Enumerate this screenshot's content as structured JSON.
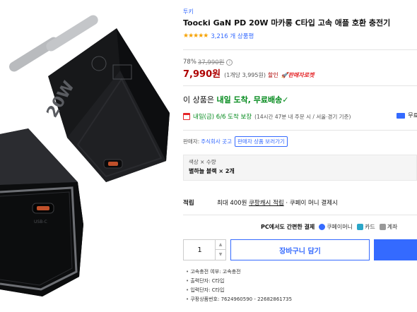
{
  "product": {
    "brand": "투키",
    "title": "Toocki GaN PD 20W 마카롱 C타입 고속 애플 호환 충전기",
    "stars": "★★★★★",
    "review_count": "3,216 개 상품평"
  },
  "price": {
    "discount_rate": "78%",
    "original_price": "37,990원",
    "sale_price": "7,990원",
    "unit_price": "(1개당 3,995원)",
    "sale_label": "할인",
    "rocket_badge": "판매자로켓"
  },
  "delivery": {
    "headline_prefix": "이 상품은",
    "headline_highlight": "내일 도착, 무료배송",
    "check": "✓",
    "date": "내일(금) 6/6 도착 보장",
    "note": "(14시간 47분 내 주문 시 / 서울⋅경기 기준)",
    "free_shipping": "무료"
  },
  "seller": {
    "label": "판매자:",
    "name": "주식회사 곳고",
    "view_button": "판매자 상품 보러가기"
  },
  "option": {
    "label": "색상 × 수량",
    "value": "별하늘 블랙 × 2개"
  },
  "cash": {
    "label": "적립",
    "prefix": "최대 400원",
    "highlight": "쿠팡캐시 적립",
    "suffix": "· 쿠페이 머니 결제시"
  },
  "payment": {
    "title": "PC에서도 간편한 결제",
    "methods": [
      {
        "label": "쿠페이머니",
        "color": "#346aff"
      },
      {
        "label": "카드",
        "color": "#2aa6c8"
      },
      {
        "label": "계좌",
        "color": "#999999"
      }
    ]
  },
  "purchase": {
    "quantity": "1",
    "cart_label": "장바구니 담기"
  },
  "specs": [
    "고속충전 여부: 고속충전",
    "출력단자: C타입",
    "입력단자: C타입",
    "쿠팡상품번호: 7624960590 - 22682861735"
  ]
}
